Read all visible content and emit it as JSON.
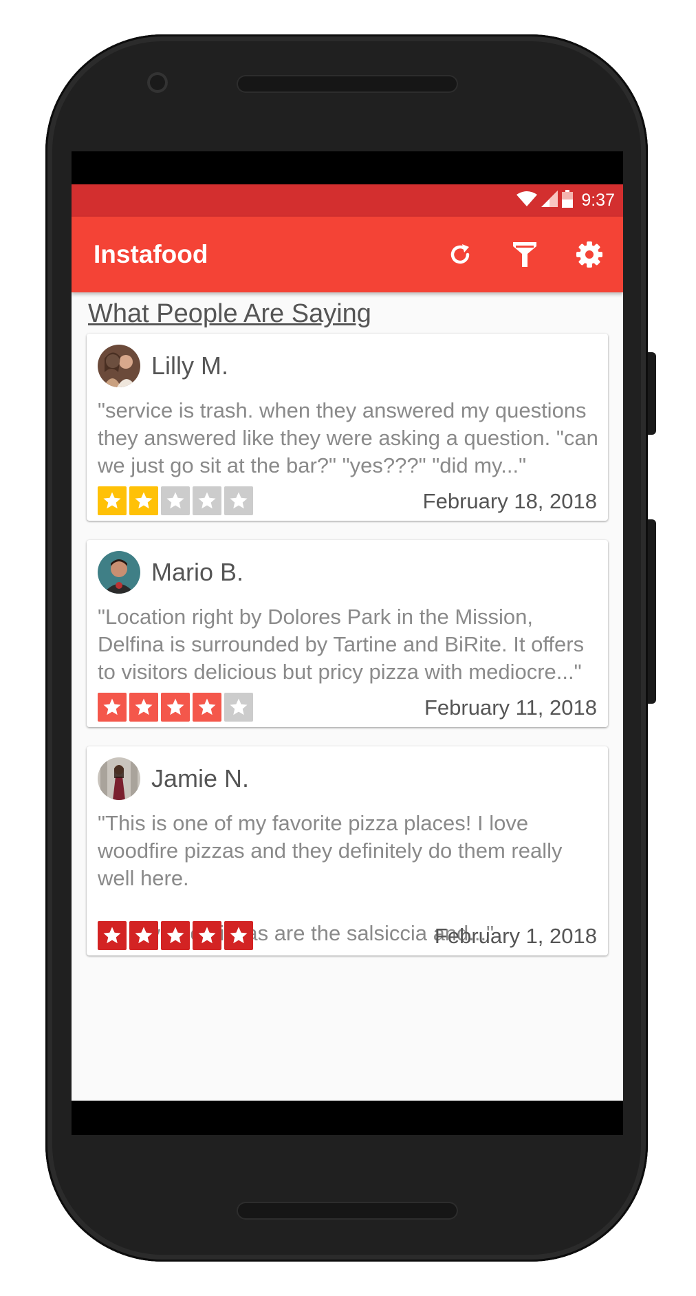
{
  "status_bar": {
    "time": "9:37"
  },
  "app_bar": {
    "title": "Instafood",
    "actions": [
      {
        "icon": "refresh-icon"
      },
      {
        "icon": "filter-icon"
      },
      {
        "icon": "settings-icon"
      }
    ]
  },
  "section": {
    "title": "What People Are Saying"
  },
  "reviews": [
    {
      "name": "Lilly M.",
      "text": "\"service is trash. when they answered my questions they answered like they were asking a question. \"can we just go sit at the bar?\" \"yes???\" \"did my...\"",
      "rating": 2,
      "date": "February 18, 2018"
    },
    {
      "name": "Mario B.",
      "text": "\"Location right by Dolores Park in the Mission, Delfina is surrounded by Tartine and BiRite. It offers to visitors delicious but pricy pizza with mediocre...\"",
      "rating": 4,
      "date": "February 11, 2018"
    },
    {
      "name": "Jamie N.",
      "text": "\"This is one of my favorite pizza places! I love woodfire pizzas and they definitely do them really well here.\n\nMy favorite pizzas are the salsiccia and...\"",
      "rating": 5,
      "date": "February 1, 2018"
    }
  ],
  "colors": {
    "primary": "#f44336",
    "primary_dark": "#d32f2f",
    "star_2": "#ffc107",
    "star_4": "#f4574b",
    "star_5": "#d32323",
    "star_empty": "#cccccc"
  }
}
